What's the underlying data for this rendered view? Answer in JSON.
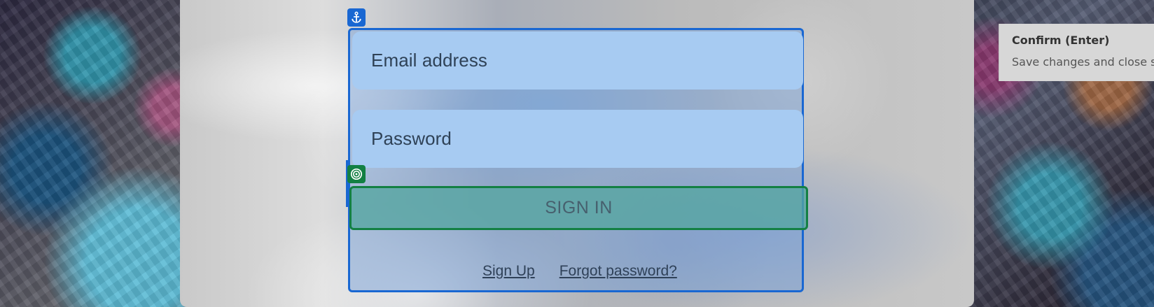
{
  "form": {
    "email_placeholder": "Email address",
    "password_placeholder": "Password",
    "sign_in_label": "SIGN IN",
    "sign_up_label": "Sign Up",
    "forgot_password_label": "Forgot password?"
  },
  "tooltip": {
    "title": "Confirm (Enter)",
    "description": "Save changes and close se"
  },
  "icons": {
    "anchor": "anchor-icon",
    "target": "target-icon"
  },
  "colors": {
    "selection_blue": "#1967d2",
    "target_green": "#138043",
    "field_fill": "#a7cbf2",
    "button_fill": "#55a5a0"
  }
}
